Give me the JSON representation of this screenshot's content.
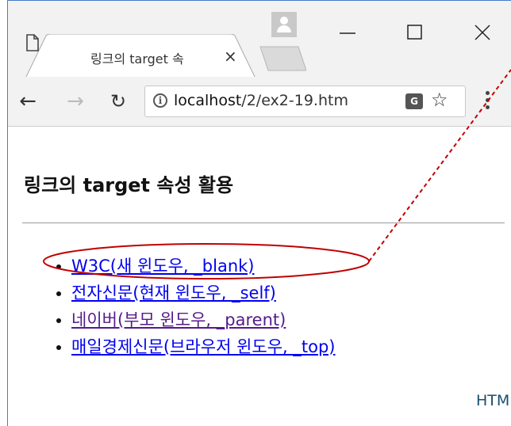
{
  "browser": {
    "tab_title": "링크의 target 속",
    "url_host": "localhost",
    "url_path": "/2/ex2-19.htm"
  },
  "icons": {
    "back": "back-arrow-icon",
    "forward": "forward-arrow-icon",
    "reload": "reload-icon",
    "info": "info-icon",
    "translate": "translate-icon",
    "star": "star-icon",
    "menu": "menu-icon",
    "close": "close-icon",
    "minimize": "minimize-icon",
    "maximize": "maximize-icon",
    "profile": "profile-icon"
  },
  "page": {
    "heading": "링크의 target 속성 활용",
    "links": [
      {
        "text": "W3C(새 윈도우, _blank)",
        "visited": false
      },
      {
        "text": "전자신문(현재 윈도우, _self)",
        "visited": false
      },
      {
        "text": "네이버(부모 윈도우, _parent)",
        "visited": true
      },
      {
        "text": "매일경제신문(브라우저 윈도우, _top)",
        "visited": false
      }
    ],
    "footer_partial": "HTM"
  },
  "colors": {
    "link": "#0000ee",
    "visited": "#551a8b",
    "annotation": "#c00000",
    "footer": "#1a4e6e"
  }
}
